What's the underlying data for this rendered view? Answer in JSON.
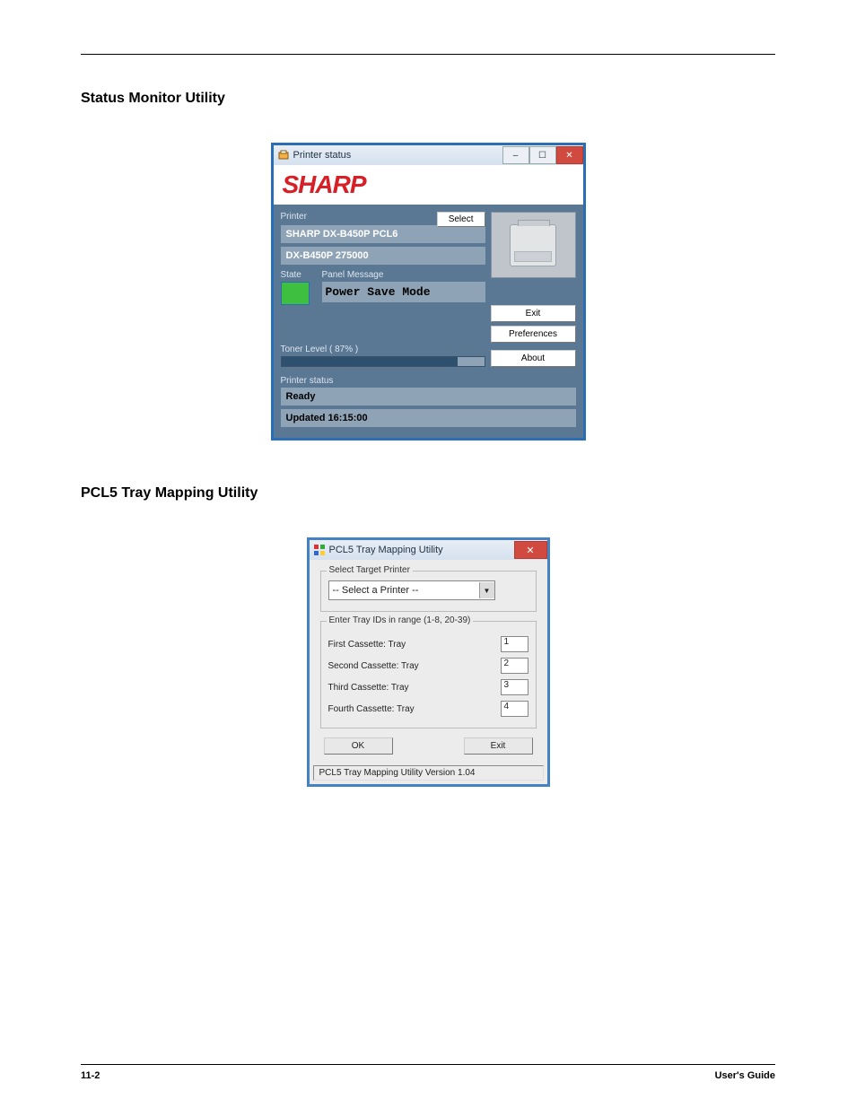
{
  "headings": {
    "status_monitor": "Status Monitor Utility",
    "pcl5": "PCL5 Tray Mapping Utility"
  },
  "printer_status": {
    "window_title": "Printer status",
    "logo_text": "SHARP",
    "printer_label": "Printer",
    "select_btn": "Select",
    "printer_line1": "SHARP DX-B450P PCL6",
    "printer_line2": "DX-B450P 275000",
    "state_label": "State",
    "panel_label": "Panel Message",
    "panel_message": "Power Save Mode",
    "toner_label": "Toner Level ( 87% )",
    "exit_btn": "Exit",
    "preferences_btn": "Preferences",
    "about_btn": "About",
    "status_label": "Printer status",
    "status_value": "Ready",
    "updated": "Updated 16:15:00"
  },
  "pcl5_window": {
    "window_title": "PCL5 Tray Mapping Utility",
    "select_target_legend": "Select Target Printer",
    "select_placeholder": "-- Select a Printer --",
    "tray_ids_legend": "Enter Tray IDs in range (1-8, 20-39)",
    "trays": [
      {
        "label": "First Cassette: Tray",
        "value": "1"
      },
      {
        "label": "Second Cassette: Tray",
        "value": "2"
      },
      {
        "label": "Third Cassette: Tray",
        "value": "3"
      },
      {
        "label": "Fourth Cassette: Tray",
        "value": "4"
      }
    ],
    "ok_btn": "OK",
    "exit_btn": "Exit",
    "footer": "PCL5 Tray Mapping Utility Version 1.04"
  },
  "footer": {
    "page_num": "11-2",
    "guide": "User's Guide"
  }
}
